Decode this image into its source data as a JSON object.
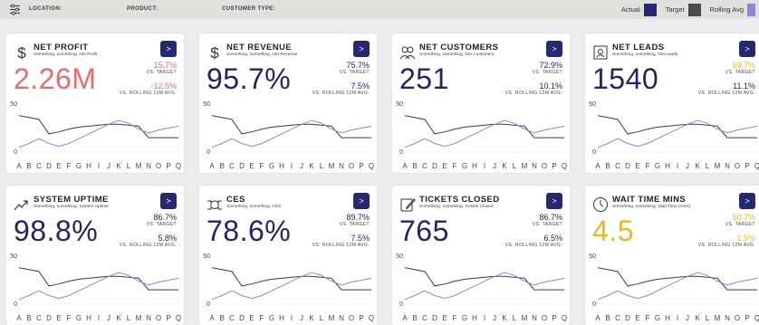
{
  "filters": {
    "location_label": "LOCATION:",
    "product_label": "PRODUCT:",
    "customer_type_label": "CUSTOMER TYPE:"
  },
  "legend": {
    "actual_label": "Actual",
    "target_label": "Target",
    "rolling_label": "Rolling Avg",
    "actual_color": "#272873",
    "target_color": "#4a4a4a",
    "rolling_color": "#8b85e8"
  },
  "colors": {
    "navy": "#23236b",
    "coral": "#f0686a",
    "gold": "#efb61e"
  },
  "chart": {
    "y_tick": "50",
    "y_zero": "0",
    "x_labels": [
      "A",
      "B",
      "C",
      "D",
      "E",
      "F",
      "G",
      "H",
      "I",
      "J",
      "K",
      "L",
      "M",
      "N",
      "O",
      "P",
      "Q"
    ]
  },
  "cards": [
    {
      "id": "net-profit",
      "icon": "dollar-icon",
      "title": "NET PROFIT",
      "subtitle": "Something, something, Net Profit",
      "value": "2.26M",
      "value_color": "#f0686a",
      "pct_target": "15.7%",
      "pct_target_color": "#f0686a",
      "vs_target": "VS. TARGET",
      "pct_rolling": "-12.5%",
      "pct_rolling_color": "#f0686a",
      "vs_rolling": "VS. ROLLING 12M AVG.",
      "button": ">"
    },
    {
      "id": "net-revenue",
      "icon": "dollar-icon",
      "title": "NET REVENUE",
      "subtitle": "Something, something, Net Revenue",
      "value": "95.7%",
      "value_color": "#23236b",
      "pct_target": "75.7%",
      "pct_target_color": "#23236b",
      "vs_target": "VS. TARGET",
      "pct_rolling": "7.5%",
      "pct_rolling_color": "#23236b",
      "vs_rolling": "VS. ROLLING 12M AVG.",
      "button": ">"
    },
    {
      "id": "net-customers",
      "icon": "people-icon",
      "title": "NET CUSTOMERS",
      "subtitle": "Something, something, Net Customers",
      "value": "251",
      "value_color": "#23236b",
      "pct_target": "72.9%",
      "pct_target_color": "#23236b",
      "vs_target": "VS. TARGET",
      "pct_rolling": "10.1%",
      "pct_rolling_color": "#23236b",
      "vs_rolling": "VS. ROLLING 12M AVG.",
      "button": ">"
    },
    {
      "id": "net-leads",
      "icon": "contact-card-icon",
      "title": "NET LEADS",
      "subtitle": "Something, something, Net Leads",
      "value": "1540",
      "value_color": "#23236b",
      "pct_target": "59.7%",
      "pct_target_color": "#efb61e",
      "vs_target": "VS. TARGET",
      "pct_rolling": "11.1%",
      "pct_rolling_color": "#23236b",
      "vs_rolling": "VS. ROLLING 12M AVG.",
      "button": ">"
    },
    {
      "id": "system-uptime",
      "icon": "trend-up-icon",
      "title": "SYSTEM UPTIME",
      "subtitle": "Something, something, System Uptime",
      "value": "98.8%",
      "value_color": "#23236b",
      "pct_target": "86.7%",
      "pct_target_color": "#23236b",
      "vs_target": "VS. TARGET",
      "pct_rolling": "5.8%",
      "pct_rolling_color": "#23236b",
      "vs_rolling": "VS. ROLLING 12M AVG.",
      "button": ">"
    },
    {
      "id": "ces",
      "icon": "handshake-icon",
      "title": "CES",
      "subtitle": "Something, something, CES",
      "value": "78.6%",
      "value_color": "#23236b",
      "pct_target": "89.7%",
      "pct_target_color": "#23236b",
      "vs_target": "VS. TARGET",
      "pct_rolling": "7.5%",
      "pct_rolling_color": "#23236b",
      "vs_rolling": "VS. ROLLING 12M AVG.",
      "button": ">"
    },
    {
      "id": "tickets-closed",
      "icon": "edit-ticket-icon",
      "title": "TICKETS CLOSED",
      "subtitle": "Something, something, Tickets Closed",
      "value": "765",
      "value_color": "#23236b",
      "pct_target": "86.7%",
      "pct_target_color": "#23236b",
      "vs_target": "VS. TARGET",
      "pct_rolling": "6.5%",
      "pct_rolling_color": "#23236b",
      "vs_rolling": "VS. ROLLING 12M AVG.",
      "button": ">"
    },
    {
      "id": "wait-time-mins",
      "icon": "clock-icon",
      "title": "WAIT TIME MINS",
      "subtitle": "Something, something, Wait Time (mins)",
      "value": "4.5",
      "value_color": "#efb61e",
      "pct_target": "50.7%",
      "pct_target_color": "#efb61e",
      "vs_target": "VS. TARGET",
      "pct_rolling": "1.5%",
      "pct_rolling_color": "#efb61e",
      "vs_rolling": "VS. ROLLING 12M AVG.",
      "button": ">"
    }
  ],
  "chart_data": {
    "type": "line",
    "categories": [
      "A",
      "B",
      "C",
      "D",
      "E",
      "F",
      "G",
      "H",
      "I",
      "J",
      "K",
      "L",
      "M",
      "N",
      "O",
      "P",
      "Q"
    ],
    "ylim": [
      0,
      50
    ],
    "series": [
      {
        "color": "#3a3a4a",
        "values": [
          38,
          36,
          34,
          19,
          21,
          24,
          26,
          27,
          28,
          29,
          29,
          28,
          27,
          15,
          15,
          15,
          15
        ]
      },
      {
        "color": "#8b85e8",
        "values": [
          5,
          9,
          14,
          9,
          6,
          9,
          14,
          19,
          24,
          29,
          33,
          30,
          24,
          20,
          23,
          25,
          27
        ]
      }
    ]
  }
}
